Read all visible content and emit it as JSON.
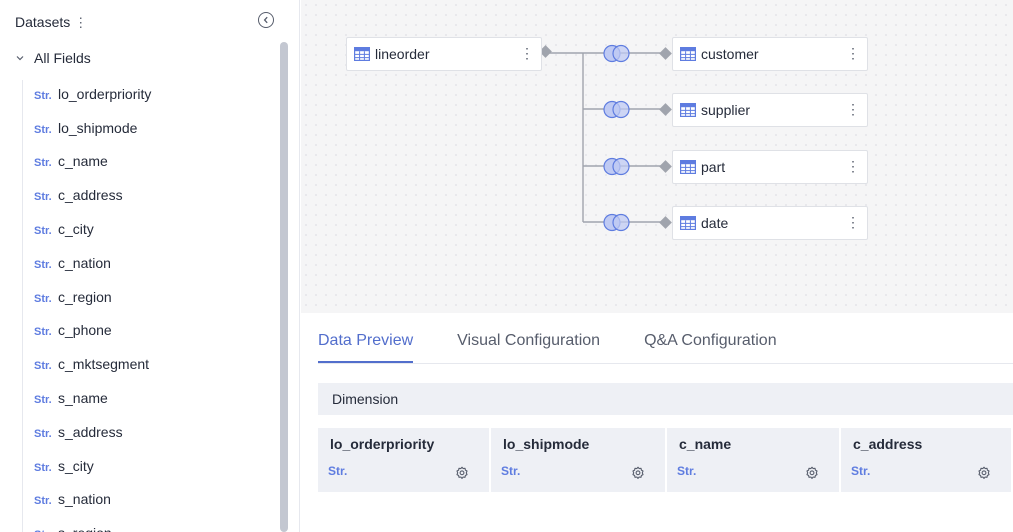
{
  "sidebar": {
    "title": "Datasets",
    "more_glyph": "⋮",
    "collapse_icon": "chevron-left-circle-icon",
    "tree_root": "All Fields",
    "fields": [
      {
        "type": "Str.",
        "name": "lo_orderpriority"
      },
      {
        "type": "Str.",
        "name": "lo_shipmode"
      },
      {
        "type": "Str.",
        "name": "c_name"
      },
      {
        "type": "Str.",
        "name": "c_address"
      },
      {
        "type": "Str.",
        "name": "c_city"
      },
      {
        "type": "Str.",
        "name": "c_nation"
      },
      {
        "type": "Str.",
        "name": "c_region"
      },
      {
        "type": "Str.",
        "name": "c_phone"
      },
      {
        "type": "Str.",
        "name": "c_mktsegment"
      },
      {
        "type": "Str.",
        "name": "s_name"
      },
      {
        "type": "Str.",
        "name": "s_address"
      },
      {
        "type": "Str.",
        "name": "s_city"
      },
      {
        "type": "Str.",
        "name": "s_nation"
      },
      {
        "type": "Str.",
        "name": "s_region"
      }
    ]
  },
  "canvas": {
    "fact_table": "lineorder",
    "dimension_tables": [
      "customer",
      "supplier",
      "part",
      "date"
    ],
    "join_icon": "venn-join-icon",
    "table_icon": "table-grid-icon",
    "kebab_glyph": "⋮"
  },
  "bottom": {
    "tabs": [
      {
        "label": "Data Preview",
        "active": true
      },
      {
        "label": "Visual Configuration",
        "active": false
      },
      {
        "label": "Q&A Configuration",
        "active": false
      }
    ],
    "section_label": "Dimension",
    "columns": [
      {
        "name": "lo_orderpriority",
        "type": "Str."
      },
      {
        "name": "lo_shipmode",
        "type": "Str."
      },
      {
        "name": "c_name",
        "type": "Str."
      },
      {
        "name": "c_address",
        "type": "Str."
      }
    ]
  },
  "colors": {
    "accent": "#526ecc",
    "type_tag": "#5e7ce0",
    "join_fill": "#bfcaf3",
    "join_stroke": "#5e7ce0",
    "canvas_bg": "#f5f5f6"
  }
}
